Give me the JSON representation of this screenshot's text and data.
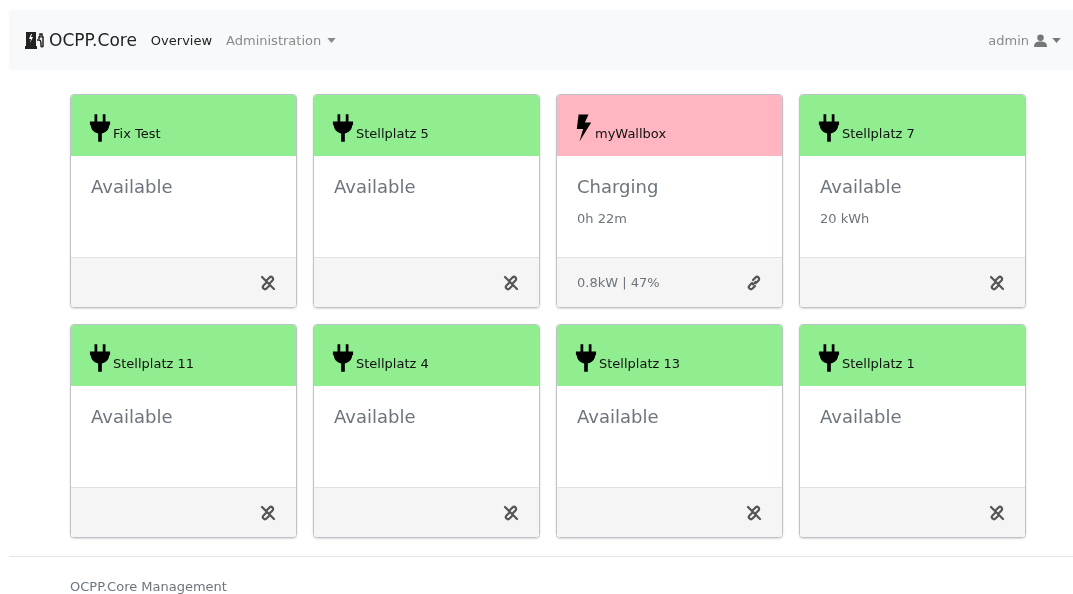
{
  "navbar": {
    "brand": "OCPP.Core",
    "links": [
      {
        "label": "Overview",
        "selected": true,
        "dropdown": false
      },
      {
        "label": "Administration",
        "selected": false,
        "dropdown": true
      }
    ],
    "user": "admin"
  },
  "chargepoints": [
    {
      "name": "Fix Test",
      "kind": "plug",
      "color": "#90ee90",
      "status": "Available",
      "connected": false
    },
    {
      "name": "Stellplatz 5",
      "kind": "plug",
      "color": "#90ee90",
      "status": "Available",
      "connected": false
    },
    {
      "name": "myWallbox",
      "kind": "bolt",
      "color": "#ffb6c1",
      "status": "Charging",
      "detail": "0h 22m",
      "footer_info": "0.8kW | 47%",
      "connected": true
    },
    {
      "name": "Stellplatz 7",
      "kind": "plug",
      "color": "#90ee90",
      "status": "Available",
      "detail": "20 kWh",
      "connected": false
    },
    {
      "name": "Stellplatz 11",
      "kind": "plug",
      "color": "#90ee90",
      "status": "Available",
      "connected": false
    },
    {
      "name": "Stellplatz 4",
      "kind": "plug",
      "color": "#90ee90",
      "status": "Available",
      "connected": false
    },
    {
      "name": "Stellplatz 13",
      "kind": "plug",
      "color": "#90ee90",
      "status": "Available",
      "connected": false
    },
    {
      "name": "Stellplatz 1",
      "kind": "plug",
      "color": "#90ee90",
      "status": "Available",
      "connected": false
    }
  ],
  "footer": "OCPP.Core Management"
}
